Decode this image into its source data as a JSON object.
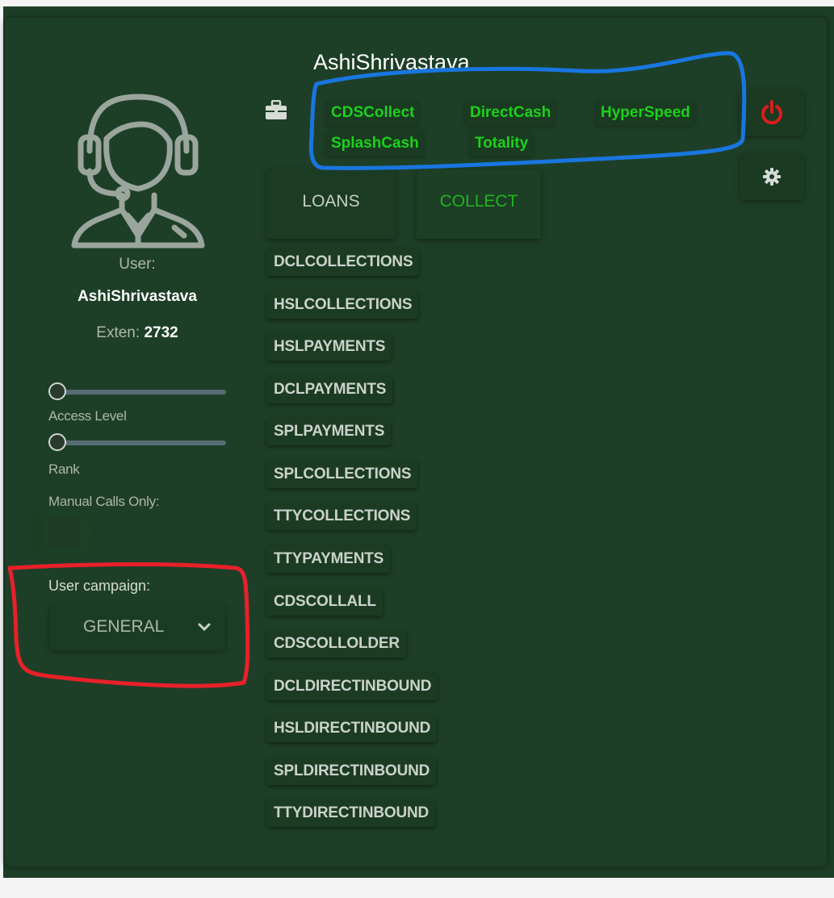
{
  "header": {
    "user_name": "AshiShrivastava",
    "campaign_tags": [
      "CDSCollect",
      "DirectCash",
      "HyperSpeed",
      "SplashCash",
      "Totality"
    ],
    "power_icon": "power-icon",
    "settings_icon": "gear-icon",
    "briefcase_icon": "briefcase-icon"
  },
  "tabs": [
    {
      "label": "LOANS",
      "active": false
    },
    {
      "label": "COLLECT",
      "active": true
    }
  ],
  "queues": [
    "DCLCOLLECTIONS",
    "HSLCOLLECTIONS",
    "HSLPAYMENTS",
    "DCLPAYMENTS",
    "SPLPAYMENTS",
    "SPLCOLLECTIONS",
    "TTYCOLLECTIONS",
    "TTYPAYMENTS",
    "CDSCOLLALL",
    "CDSCOLLOLDER",
    "DCLDIRECTINBOUND",
    "HSLDIRECTINBOUND",
    "SPLDIRECTINBOUND",
    "TTYDIRECTINBOUND"
  ],
  "sidebar": {
    "avatar_icon": "headset-agent-icon",
    "user_label": "User:",
    "user_name": "AshiShrivastava",
    "exten_label": "Exten:",
    "exten_value": "2732",
    "access_level_label": "Access Level",
    "access_level_value": 0,
    "rank_label": "Rank",
    "rank_value": 0,
    "manual_calls_label": "Manual Calls Only:",
    "manual_calls_checked": false,
    "campaign_label": "User campaign:",
    "campaign_value": "GENERAL"
  },
  "colors": {
    "background": "#1e3f27",
    "tag_text": "#1bd11b",
    "active_tab": "#1fb51f",
    "power": "#e01b1b",
    "annotation_blue": "#1976e0",
    "annotation_red": "#e8202a"
  }
}
